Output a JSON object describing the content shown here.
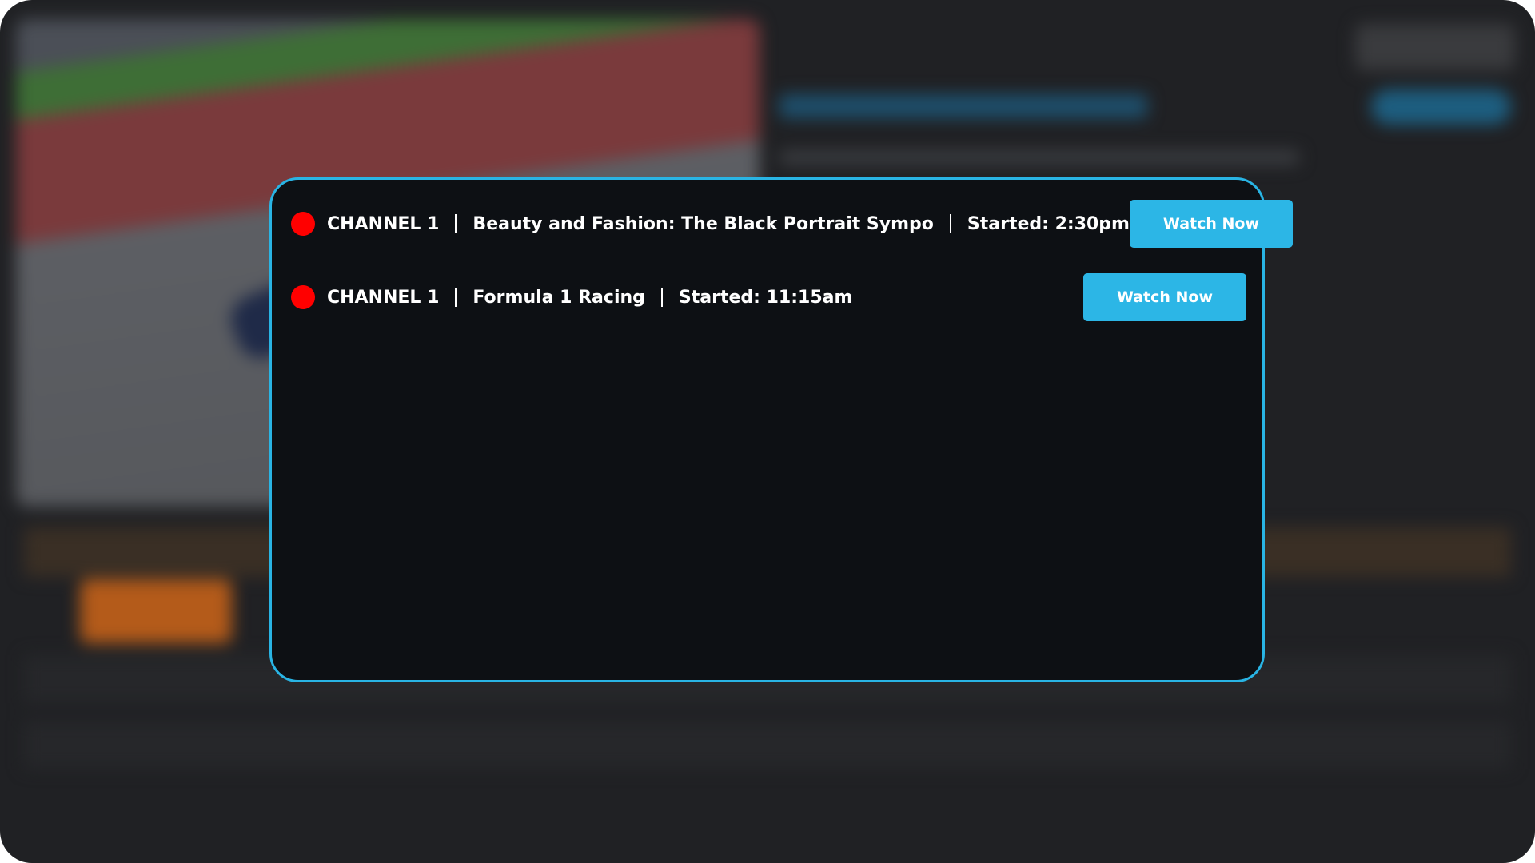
{
  "live_list": {
    "items": [
      {
        "channel": "CHANNEL 1",
        "title": "Beauty and Fashion: The Black Portrait Sympo",
        "started": "Started: 2:30pm",
        "button_label": "Watch Now"
      },
      {
        "channel": "CHANNEL 1",
        "title": "Formula 1 Racing",
        "started": "Started: 11:15am",
        "button_label": "Watch Now"
      }
    ]
  },
  "colors": {
    "accent": "#29b4e4",
    "live_indicator": "#ff0000",
    "popup_background": "#0d1014",
    "page_background": "#202124"
  },
  "icons": {
    "live_indicator": "live-dot-icon"
  }
}
